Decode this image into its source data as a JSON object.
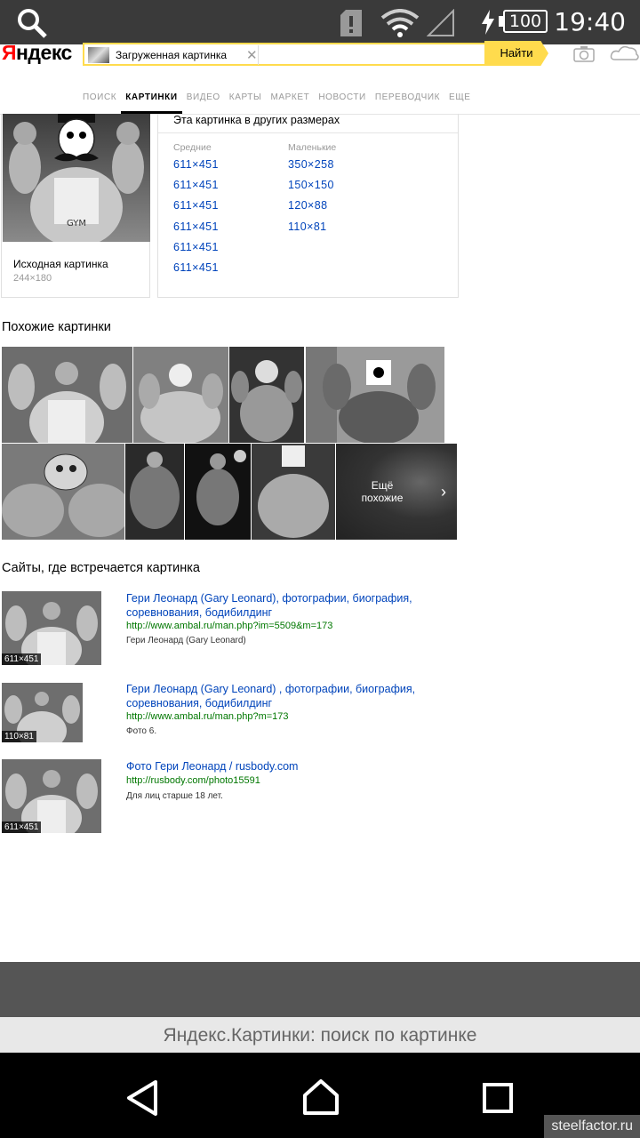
{
  "status_bar": {
    "time": "19:40",
    "battery": "100"
  },
  "header": {
    "logo": "Яндекс",
    "search_chip": "Загруженная картинка",
    "find_button": "Найти"
  },
  "tabs": [
    "ПОИСК",
    "КАРТИНКИ",
    "ВИДЕО",
    "КАРТЫ",
    "МАРКЕТ",
    "НОВОСТИ",
    "ПЕРЕВОДЧИК",
    "ЕЩЕ"
  ],
  "original": {
    "caption": "Исходная картинка",
    "size": "244×180"
  },
  "sizes": {
    "title": "Эта картинка в других размерах",
    "medium_label": "Средние",
    "medium": [
      "611×451",
      "611×451",
      "611×451",
      "611×451",
      "611×451",
      "611×451"
    ],
    "small_label": "Маленькие",
    "small": [
      "350×258",
      "150×150",
      "120×88",
      "110×81"
    ]
  },
  "similar": {
    "title": "Похожие картинки",
    "more_label": "Ещё похожие"
  },
  "sites": {
    "title": "Сайты, где встречается картинка",
    "items": [
      {
        "badge": "611×451",
        "title": "Гери Леонард (Gary Leonard), фотографии, биография, соревнования, бодибилдинг",
        "url": "http://www.ambal.ru/man.php?im=5509&m=173",
        "desc": "Гери Леонард (Gary Leonard)"
      },
      {
        "badge": "110×81",
        "title": "Гери Леонард (Gary Leonard) , фотографии, биография, соревнования, бодибилдинг",
        "url": "http://www.ambal.ru/man.php?m=173",
        "desc": "Фото 6."
      },
      {
        "badge": "611×451",
        "title": "Фото Гери Леонард / rusbody.com",
        "url": "http://rusbody.com/photo15591",
        "desc": "Для лиц старше 18 лет."
      }
    ]
  },
  "page_title": "Яндекс.Картинки: поиск по картинке",
  "watermark": "steelfactor.ru"
}
